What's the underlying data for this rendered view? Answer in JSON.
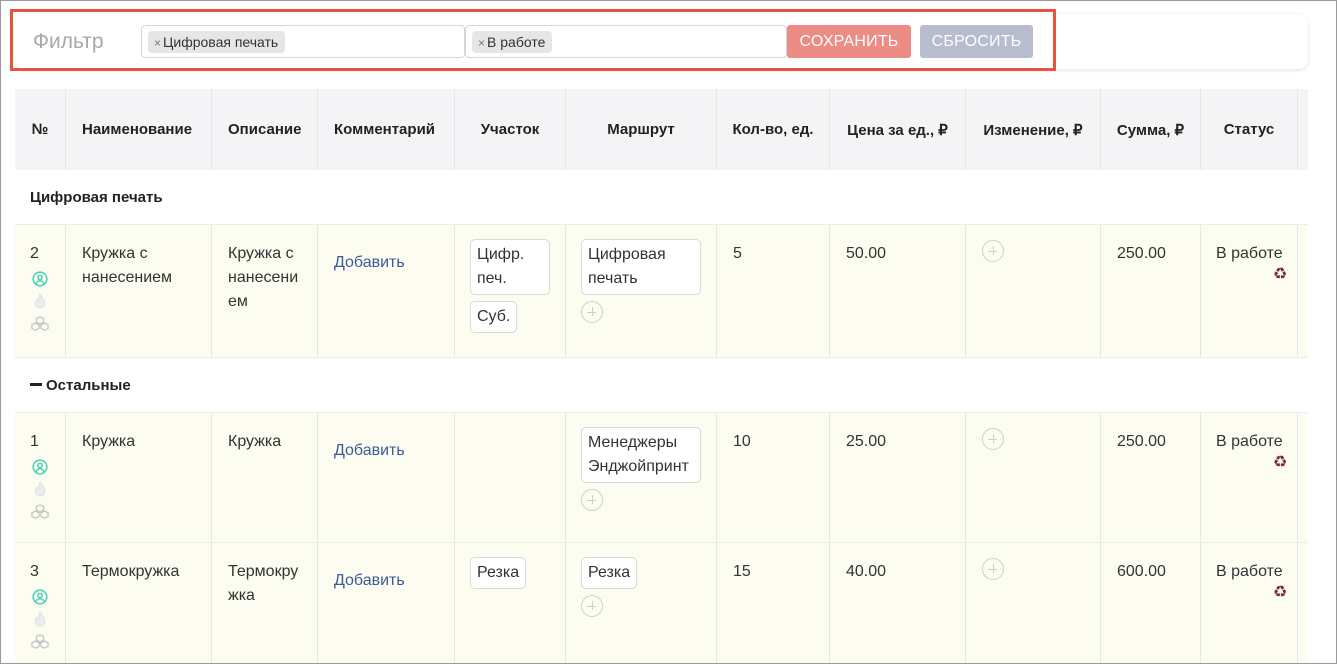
{
  "filter": {
    "label": "Фильтр",
    "chip_one": "Цифровая печать",
    "chip_two": "В работе",
    "chip_remove": "×",
    "save_label": "СОХРАНИТЬ",
    "reset_label": "СБРОСИТЬ"
  },
  "table": {
    "columns": [
      "№",
      "Наименование",
      "Описание",
      "Комментарий",
      "Участок",
      "Маршрут",
      "Кол-во, ед.",
      "Цена за ед., ₽",
      "Изменение, ₽",
      "Сумма, ₽",
      "Статус"
    ],
    "groups": [
      {
        "title": "Цифровая печать"
      },
      {
        "title": "Остальные",
        "collapse_icon": "minus-icon"
      }
    ],
    "rows": [
      {
        "num": "2",
        "name_1": "Кружка с",
        "name_2": "нанесением",
        "desc_1": "Кружка с",
        "desc_2": "нанесени",
        "desc_3": "ем",
        "comment": "Добавить",
        "section_1a": "Цифр.",
        "section_1b": "печ.",
        "section_2": "Суб.",
        "route_1a": "Цифровая",
        "route_1b": "печать",
        "qty": "5",
        "price": "50.00",
        "sum": "250.00",
        "status": "В работе"
      },
      {
        "num": "1",
        "name_1": "Кружка",
        "desc_1": "Кружка",
        "comment": "Добавить",
        "route_1a": "Менеджеры",
        "route_1b": "Энджойпринт",
        "qty": "10",
        "price": "25.00",
        "sum": "250.00",
        "status": "В работе"
      },
      {
        "num": "3",
        "name_1": "Термокружка",
        "desc_1": "Термокру",
        "desc_2": "жка",
        "comment": "Добавить",
        "section_1a": "Резка",
        "route_1a": "Резка",
        "qty": "15",
        "price": "40.00",
        "sum": "600.00",
        "status": "В работе"
      }
    ]
  },
  "icons": {
    "user": "user-circle-icon",
    "fire": "fire-icon",
    "boxes": "boxes-icon",
    "plus": "plus-circle-icon",
    "recycle": "recycle-icon",
    "recycle_glyph": "♻"
  },
  "colors": {
    "save_button": "#ec8c84",
    "reset_button": "#b7bccf",
    "highlight": "#e8533c",
    "link": "#3d5a98",
    "user_icon": "#4fd1b8",
    "recycle_icon": "#7a2a2a",
    "row_background": "#fcfdf0"
  }
}
